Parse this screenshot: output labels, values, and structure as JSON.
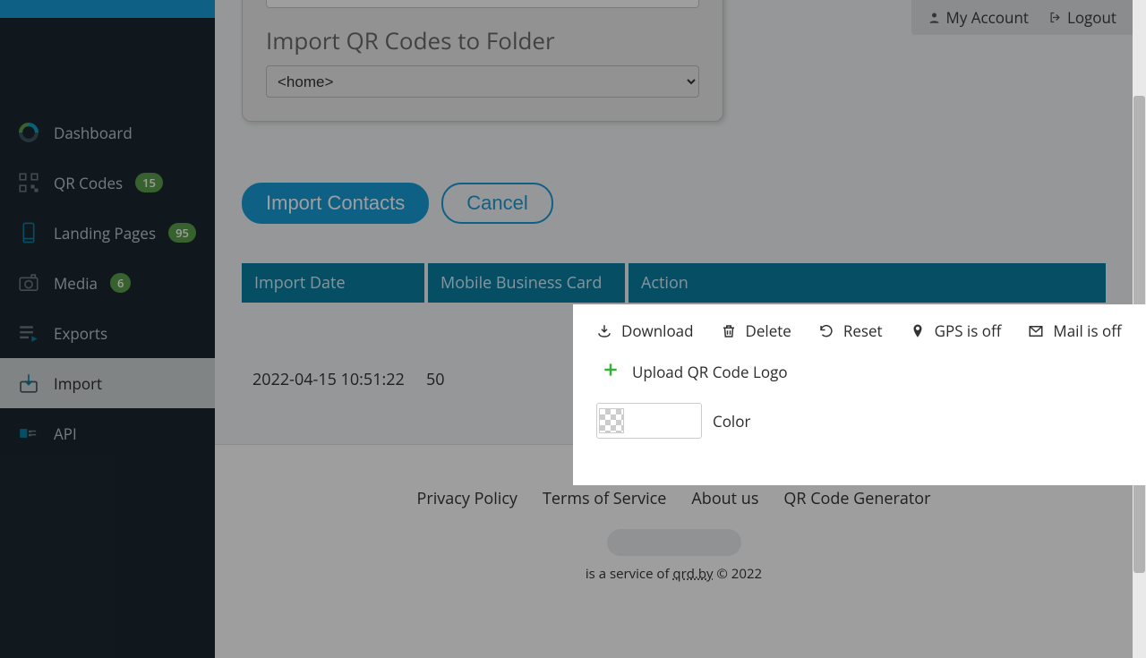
{
  "account": {
    "my_account": "My Account",
    "logout": "Logout"
  },
  "sidebar": {
    "items": [
      {
        "label": "Dashboard"
      },
      {
        "label": "QR Codes",
        "badge": "15"
      },
      {
        "label": "Landing Pages",
        "badge": "95"
      },
      {
        "label": "Media",
        "badge": "6"
      },
      {
        "label": "Exports"
      },
      {
        "label": "Import"
      },
      {
        "label": "API"
      }
    ]
  },
  "import_card": {
    "title": "Import QR Codes to Folder",
    "folder_selected": "<home>"
  },
  "buttons": {
    "import": "Import Contacts",
    "cancel": "Cancel"
  },
  "table": {
    "headers": [
      "Import Date",
      "Mobile Business Card",
      "Action"
    ],
    "rows": [
      {
        "date": "2022-04-15 10:51:22",
        "count": "50"
      }
    ]
  },
  "popover": {
    "download": "Download",
    "delete": "Delete",
    "reset": "Reset",
    "gps": "GPS is off",
    "mail": "Mail is off",
    "upload": "Upload QR Code Logo",
    "color": "Color"
  },
  "footer": {
    "links": [
      "Privacy Policy",
      "Terms of Service",
      "About us",
      "QR Code Generator"
    ],
    "note_pre": "is a service of ",
    "note_link": "qrd.by",
    "note_post": " © 2022"
  }
}
